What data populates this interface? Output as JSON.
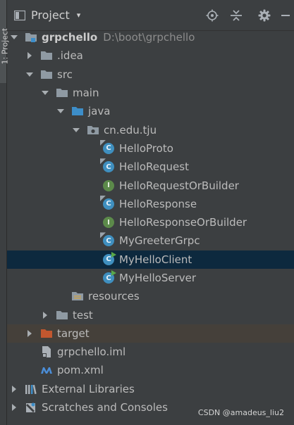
{
  "left_strip": {
    "tab_label": "1: Project"
  },
  "header": {
    "title": "Project",
    "dropdown_caret": "▾"
  },
  "tree": [
    {
      "name": "grpchello",
      "path": "D:\\boot\\grpchello",
      "icon": "module-folder-icon",
      "arrow": "down",
      "bold": true
    },
    {
      "name": ".idea",
      "icon": "folder-icon",
      "arrow": "right"
    },
    {
      "name": "src",
      "icon": "folder-icon",
      "arrow": "down"
    },
    {
      "name": "main",
      "icon": "folder-icon",
      "arrow": "down"
    },
    {
      "name": "java",
      "icon": "source-folder-icon",
      "arrow": "down"
    },
    {
      "name": "cn.edu.tju",
      "icon": "package-icon",
      "arrow": "down"
    },
    {
      "name": "HelloProto",
      "icon": "class-icon",
      "letter": "C"
    },
    {
      "name": "HelloRequest",
      "icon": "class-icon",
      "letter": "C"
    },
    {
      "name": "HelloRequestOrBuilder",
      "icon": "interface-icon",
      "letter": "I"
    },
    {
      "name": "HelloResponse",
      "icon": "class-icon",
      "letter": "C"
    },
    {
      "name": "HelloResponseOrBuilder",
      "icon": "interface-icon",
      "letter": "I"
    },
    {
      "name": "MyGreeterGrpc",
      "icon": "class-icon",
      "letter": "C"
    },
    {
      "name": "MyHelloClient",
      "icon": "runnable-class-icon",
      "letter": "C",
      "selected": true
    },
    {
      "name": "MyHelloServer",
      "icon": "runnable-class-icon",
      "letter": "C"
    },
    {
      "name": "resources",
      "icon": "resources-folder-icon"
    },
    {
      "name": "test",
      "icon": "folder-icon",
      "arrow": "right"
    },
    {
      "name": "target",
      "icon": "excluded-folder-icon",
      "arrow": "right",
      "highlight": true
    },
    {
      "name": "grpchello.iml",
      "icon": "iml-file-icon"
    },
    {
      "name": "pom.xml",
      "icon": "maven-icon"
    },
    {
      "name": "External Libraries",
      "icon": "libraries-icon",
      "arrow": "right"
    },
    {
      "name": "Scratches and Consoles",
      "icon": "scratches-icon",
      "arrow": "right"
    }
  ],
  "watermark": "CSDN @amadeus_liu2",
  "colors": {
    "background": "#3c3f41",
    "selection": "#0d293e",
    "target_highlight": "#45403a",
    "class_icon": "#3f8fbf",
    "interface_icon": "#5c8a4a",
    "folder": "#8f9aa3",
    "source_folder": "#3d8ec9",
    "excluded_folder": "#c2572f"
  }
}
